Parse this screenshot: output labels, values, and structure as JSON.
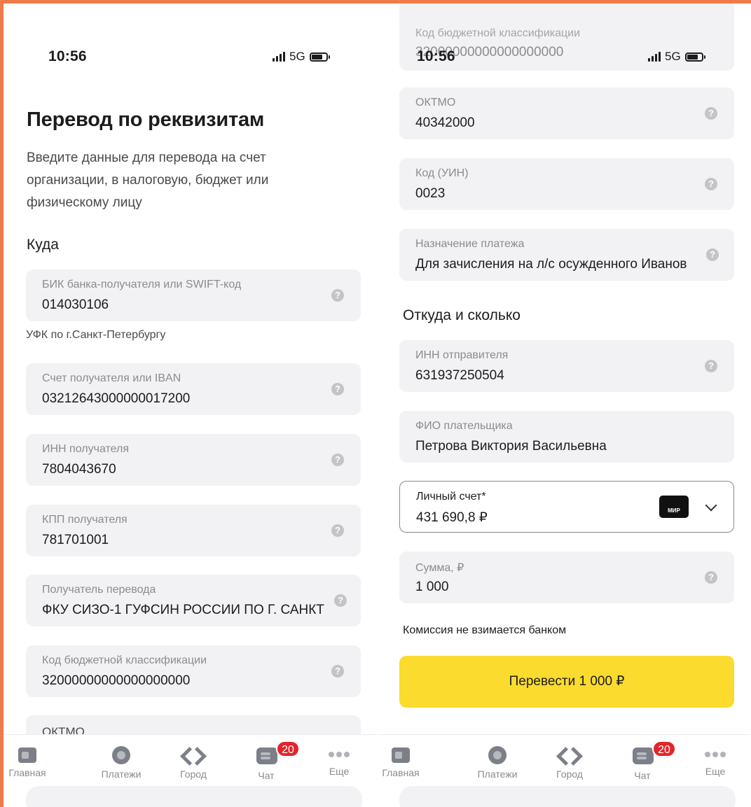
{
  "status": {
    "time": "10:56",
    "network": "5G"
  },
  "left": {
    "title": "Перевод по реквизитам",
    "subtitle": "Введите данные для перевода на счет организации, в налоговую, бюджет или физическому лицу",
    "section_to": "Куда",
    "bik": {
      "label": "БИК банка-получателя или SWIFT-код",
      "value": "014030106",
      "note": "УФК по г.Санкт-Петербургу"
    },
    "account": {
      "label": "Счет получателя или IBAN",
      "value": "03212643000000017200"
    },
    "inn": {
      "label": "ИНН получателя",
      "value": "7804043670"
    },
    "kpp": {
      "label": "КПП получателя",
      "value": "781701001"
    },
    "recipient": {
      "label": "Получатель перевода",
      "value": "ФКУ СИЗО-1 ГУФСИН РОССИИ ПО Г. САНКТ"
    },
    "kbk": {
      "label": "Код бюджетной классификации",
      "value": "32000000000000000000"
    },
    "oktmo_partial": {
      "label": "ОКТМО"
    }
  },
  "right": {
    "kbk_partial": {
      "label": "Код бюджетной классификации",
      "value": "32000000000000000000"
    },
    "oktmo": {
      "label": "ОКТМО",
      "value": "40342000"
    },
    "uin": {
      "label": "Код (УИН)",
      "value": "0023"
    },
    "purpose": {
      "label": "Назначение платежа",
      "value": "Для зачисления на л/с осужденного Иванов"
    },
    "section_from": "Откуда и сколько",
    "sender_inn": {
      "label": "ИНН отправителя",
      "value": "631937250504"
    },
    "payer_name": {
      "label": "ФИО плательщика",
      "value": "Петрова Виктория Васильевна"
    },
    "account": {
      "label": "Личный счет*",
      "value": "431 690,8 ₽",
      "card": "МИР"
    },
    "amount": {
      "label": "Сумма, ₽",
      "value": "1 000"
    },
    "commission_note": "Комиссия не взимается банком",
    "submit_button": "Перевести 1 000 ₽"
  },
  "tabbar": {
    "home": "Главная",
    "payments": "Платежи",
    "city": "Город",
    "chat": "Чат",
    "chat_badge": "20",
    "more": "Еще"
  },
  "help_glyph": "?",
  "colors": {
    "accent": "#fbdb2d",
    "badge": "#e3242b",
    "frame": "#f07a4a",
    "field_bg": "#f2f2f5"
  }
}
